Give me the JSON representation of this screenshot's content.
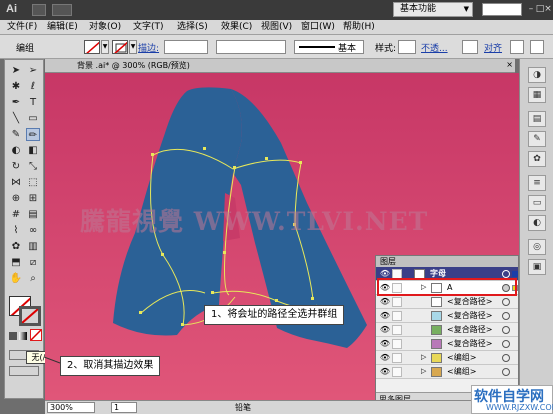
{
  "app": {
    "logo": "Ai",
    "workspace": "基本功能",
    "colors": {
      "canvas_bg": "#c83b68",
      "letter_fill": "#2b6196",
      "path_stroke": "#e8e85a",
      "highlight": "#e0191c",
      "layer_color": "#1a3ea8"
    }
  },
  "window_controls": {
    "minimize": "–",
    "maximize": "□",
    "close": "×"
  },
  "menu": [
    "文件(F)",
    "编辑(E)",
    "对象(O)",
    "文字(T)",
    "选择(S)",
    "效果(C)",
    "视图(V)",
    "窗口(W)",
    "帮助(H)"
  ],
  "control_bar": {
    "selection": "编组",
    "stroke_label": "描边:",
    "brush": "基本",
    "style_label": "样式:",
    "opacity_label": "不透...",
    "align_label": "对齐"
  },
  "document": {
    "tab_title": "背景 .ai* @ 300% (RGB/预览)",
    "close": "×"
  },
  "canvas": {
    "watermark": "騰龍視覺 WWW.TLVI.NET"
  },
  "tooltip": "无(/)",
  "callouts": {
    "group": "1、将会址的路径全选并群组",
    "stroke": "2、取消其描边效果"
  },
  "layers": {
    "title": "图层",
    "rows": [
      {
        "name": "字母",
        "type": "layer"
      },
      {
        "name": "A",
        "type": "group"
      },
      {
        "name": "<复合路径>",
        "type": "path"
      },
      {
        "name": "<复合路径>",
        "type": "path"
      },
      {
        "name": "<复合路径>",
        "type": "path"
      },
      {
        "name": "<复合路径>",
        "type": "path"
      },
      {
        "name": "<编组>",
        "type": "group"
      },
      {
        "name": "<编组>",
        "type": "group"
      }
    ],
    "count": "思多图层"
  },
  "status": {
    "zoom": "300%",
    "page": "1",
    "mode": "铅笔"
  },
  "watermark_corner": {
    "cn": "软件自学网",
    "url": "WWW.RJZXW.COM"
  }
}
